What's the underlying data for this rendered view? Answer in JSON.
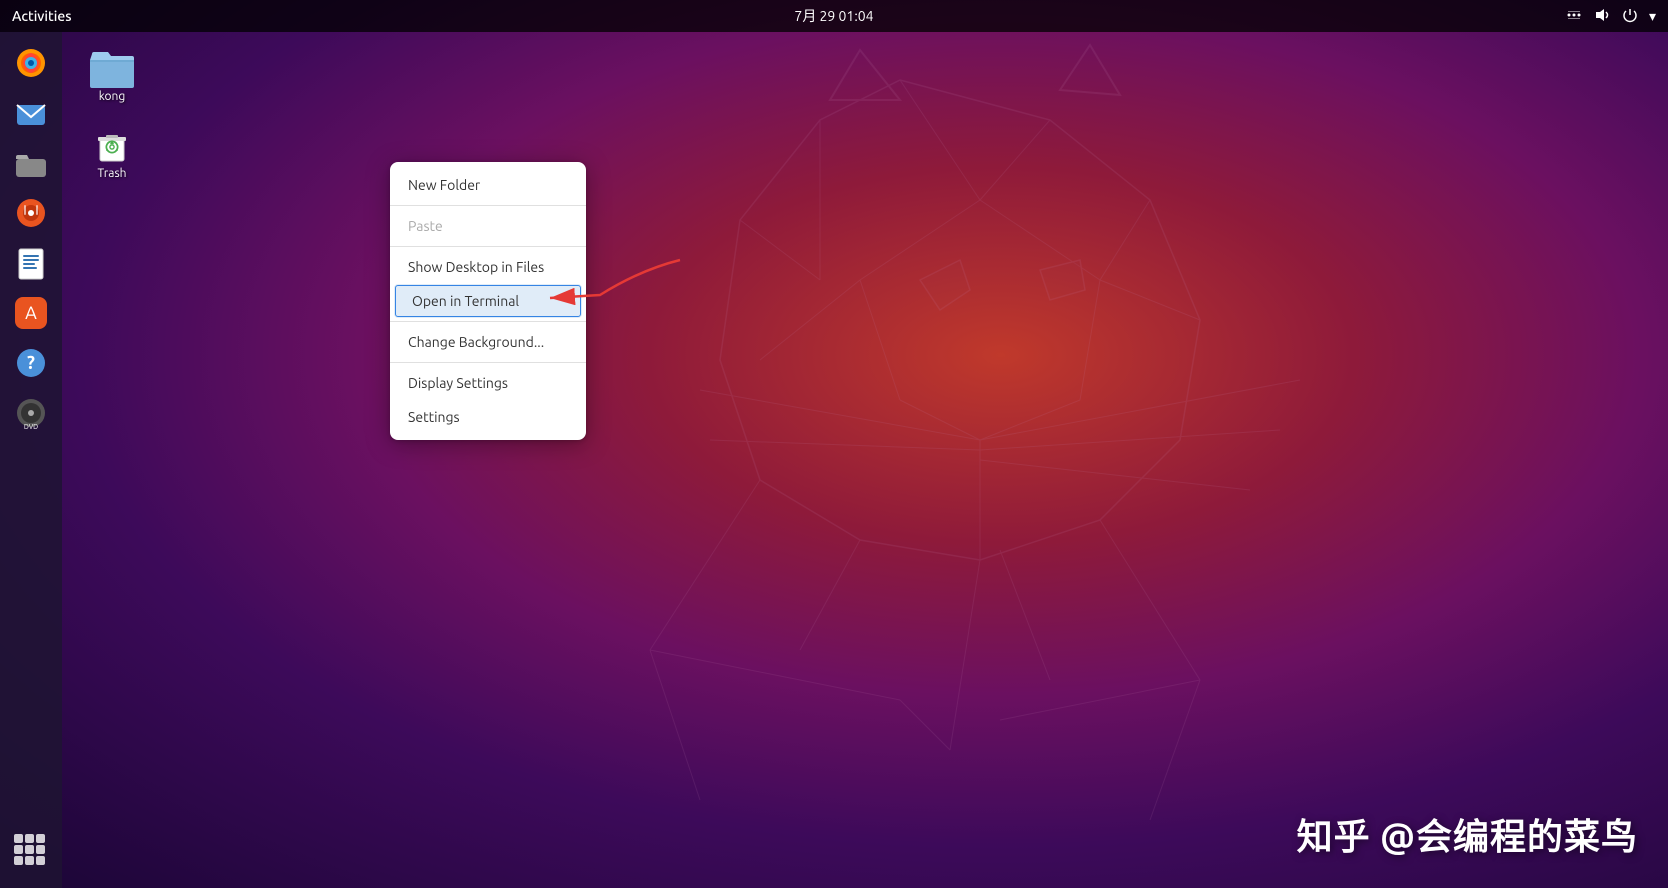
{
  "topbar": {
    "activities": "Activities",
    "datetime": "7月 29  01:04"
  },
  "dock": {
    "items": [
      {
        "name": "firefox",
        "label": "Firefox",
        "icon": "🦊"
      },
      {
        "name": "email",
        "label": "Email",
        "icon": "✉️"
      },
      {
        "name": "files",
        "label": "Files",
        "icon": "📁"
      },
      {
        "name": "rhythmbox",
        "label": "Rhythmbox",
        "icon": "🎵"
      },
      {
        "name": "writer",
        "label": "Writer",
        "icon": "📝"
      },
      {
        "name": "appstore",
        "label": "App Store",
        "icon": "🛍️"
      },
      {
        "name": "help",
        "label": "Help",
        "icon": "❓"
      },
      {
        "name": "dvd",
        "label": "DVD",
        "icon": "💿"
      }
    ],
    "apps_grid_label": "Show Applications"
  },
  "desktop": {
    "icons": [
      {
        "name": "kong",
        "label": "kong",
        "type": "folder"
      },
      {
        "name": "trash",
        "label": "Trash",
        "type": "trash"
      }
    ]
  },
  "context_menu": {
    "items": [
      {
        "id": "new-folder",
        "label": "New Folder",
        "enabled": true,
        "highlighted": false
      },
      {
        "id": "separator1",
        "type": "separator"
      },
      {
        "id": "paste",
        "label": "Paste",
        "enabled": false,
        "highlighted": false
      },
      {
        "id": "separator2",
        "type": "separator"
      },
      {
        "id": "show-desktop",
        "label": "Show Desktop in Files",
        "enabled": true,
        "highlighted": false
      },
      {
        "id": "open-terminal",
        "label": "Open in Terminal",
        "enabled": true,
        "highlighted": true
      },
      {
        "id": "separator3",
        "type": "separator"
      },
      {
        "id": "change-background",
        "label": "Change Background...",
        "enabled": true,
        "highlighted": false
      },
      {
        "id": "separator4",
        "type": "separator"
      },
      {
        "id": "display-settings",
        "label": "Display Settings",
        "enabled": true,
        "highlighted": false
      },
      {
        "id": "settings",
        "label": "Settings",
        "enabled": true,
        "highlighted": false
      }
    ]
  },
  "watermark": {
    "text": "知乎 @会编程的菜鸟"
  },
  "topbar_icons": {
    "network": "⇅",
    "volume": "🔊",
    "power": "⏻",
    "menu": "▾"
  }
}
